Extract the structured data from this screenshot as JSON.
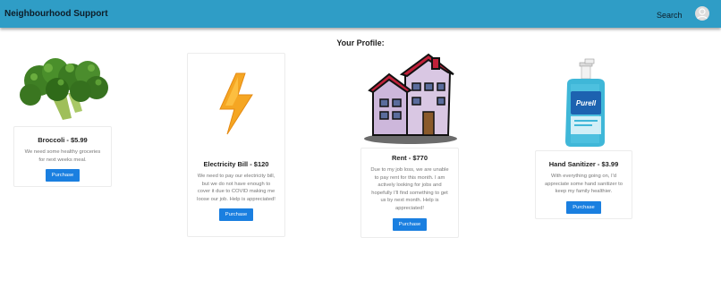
{
  "header": {
    "brand": "Neighbourhood Support",
    "search_label": "Search"
  },
  "page": {
    "heading": "Your Profile:"
  },
  "cards": [
    {
      "title": "Broccoli - $5.99",
      "description": "We need some healthy groceries for next weeks meal.",
      "button": "Purchase"
    },
    {
      "title": "Electricity Bill - $120",
      "description": "We need to pay our electricity bill, but we do not have enough to cover it due to COVID making me loose our job. Help is appreciated!",
      "button": "Purchase"
    },
    {
      "title": "Rent - $770",
      "description": "Due to my job loss, we are unable to pay rent for this month. I am actively looking for jobs and hopefully I'll find something to get us by next month. Help is appreciated!",
      "button": "Purchase"
    },
    {
      "title": "Hand Sanitizer - $3.99",
      "description": "With everything going on, I'd appreciate some hand sanitizer to keep my family healthier.",
      "button": "Purchase"
    }
  ],
  "product_label": {
    "brand": "Purell"
  },
  "colors": {
    "appbar": "#2f9dc6",
    "button": "#1a7fe0",
    "bolt": "#f5a623"
  }
}
